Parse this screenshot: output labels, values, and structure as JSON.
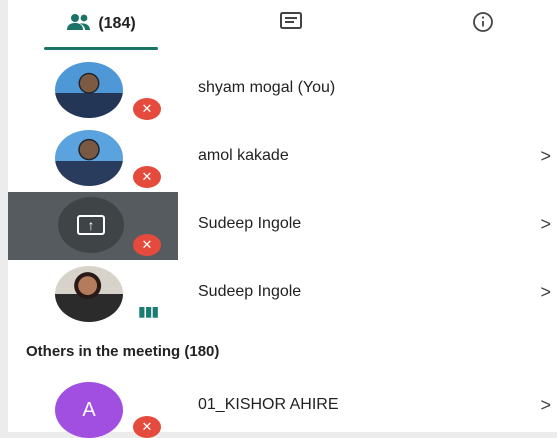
{
  "tabs": {
    "people_count": "(184)",
    "chat_label": "",
    "info_label": ""
  },
  "participants": [
    {
      "name": "shyam mogal (You)",
      "muted": true,
      "avatar": "photo-1"
    },
    {
      "name": "amol kakade",
      "muted": true,
      "avatar": "photo-2",
      "chevron": ">"
    },
    {
      "name": "Sudeep Ingole",
      "muted": true,
      "avatar": "screen-share",
      "chevron": ">"
    },
    {
      "name": "Sudeep Ingole",
      "muted": false,
      "avatar": "photo-3",
      "chevron": ">"
    }
  ],
  "others": {
    "title": "Others in the meeting (180)",
    "items": [
      {
        "name": "01_KISHOR AHIRE",
        "initial": "A",
        "chevron": ">"
      }
    ]
  },
  "colors": {
    "accent": "#1a7366",
    "mute_badge": "#e54b3d",
    "avatar_purple": "#a14fe0"
  }
}
